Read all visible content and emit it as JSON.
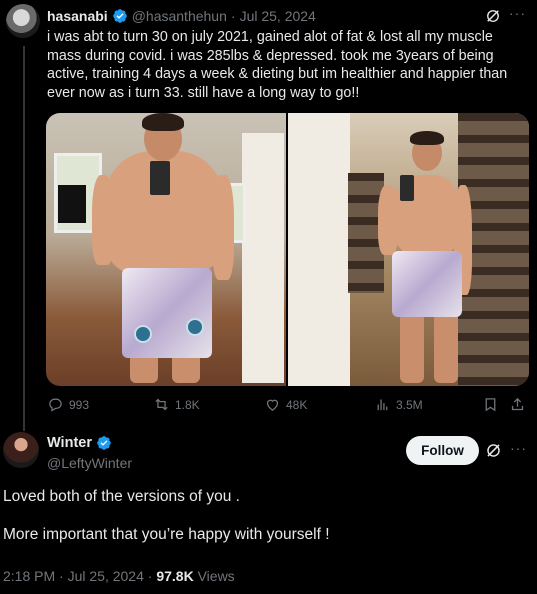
{
  "parent_tweet": {
    "author_name": "hasanabi",
    "author_handle": "@hasanthehun",
    "separator": "·",
    "date": "Jul 25, 2024",
    "text": "i was abt to turn 30 on july 2021, gained alot of fat & lost all my muscle mass during covid. i was 285lbs & depressed. took me 3years of being active, training 4 days a week & dieting but im healthier and happier than ever now as i turn 33. still have a long way to go!!",
    "more_label": "···",
    "stats": {
      "replies": "993",
      "reposts": "1.8K",
      "likes": "48K",
      "views": "3.5M"
    },
    "icons": [
      "verified-icon",
      "grok-icon",
      "more-icon",
      "reply-icon",
      "repost-icon",
      "like-icon",
      "views-icon",
      "bookmark-icon",
      "share-icon"
    ]
  },
  "reply_tweet": {
    "author_name": "Winter",
    "author_handle": "@LeftyWinter",
    "follow_label": "Follow",
    "more_label": "···",
    "text_lines": [
      "Loved both of the versions of you .",
      "More important that you’re happy with yourself !"
    ],
    "time": "2:18 PM",
    "separator": "·",
    "date": "Jul 25, 2024",
    "views_count": "97.8K",
    "views_label": "Views"
  },
  "colors": {
    "background": "#000000",
    "text_primary": "#e7e9ea",
    "text_secondary": "#71767b",
    "verified_blue": "#1d9bf0",
    "follow_button_bg": "#eff3f4",
    "follow_button_text": "#0f1419"
  }
}
